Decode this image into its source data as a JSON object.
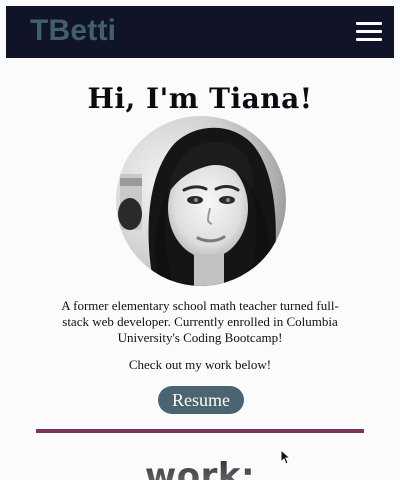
{
  "navbar": {
    "brand": "TBetti",
    "menu_icon": "hamburger-menu-icon",
    "background": "#111428",
    "brand_color": "#41606d"
  },
  "hero": {
    "title": "Hi, I'm Tiana!",
    "avatar_alt": "Portrait photo of Tiana"
  },
  "about": {
    "bio": "A former elementary school math teacher turned full-stack web developer. Currently enrolled in Columbia University's Coding Bootcamp!",
    "cta": "Check out my work below!",
    "resume_label": "Resume",
    "resume_color": "#4a6470",
    "divider_color": "#7b3558"
  },
  "work": {
    "title": "work:"
  }
}
